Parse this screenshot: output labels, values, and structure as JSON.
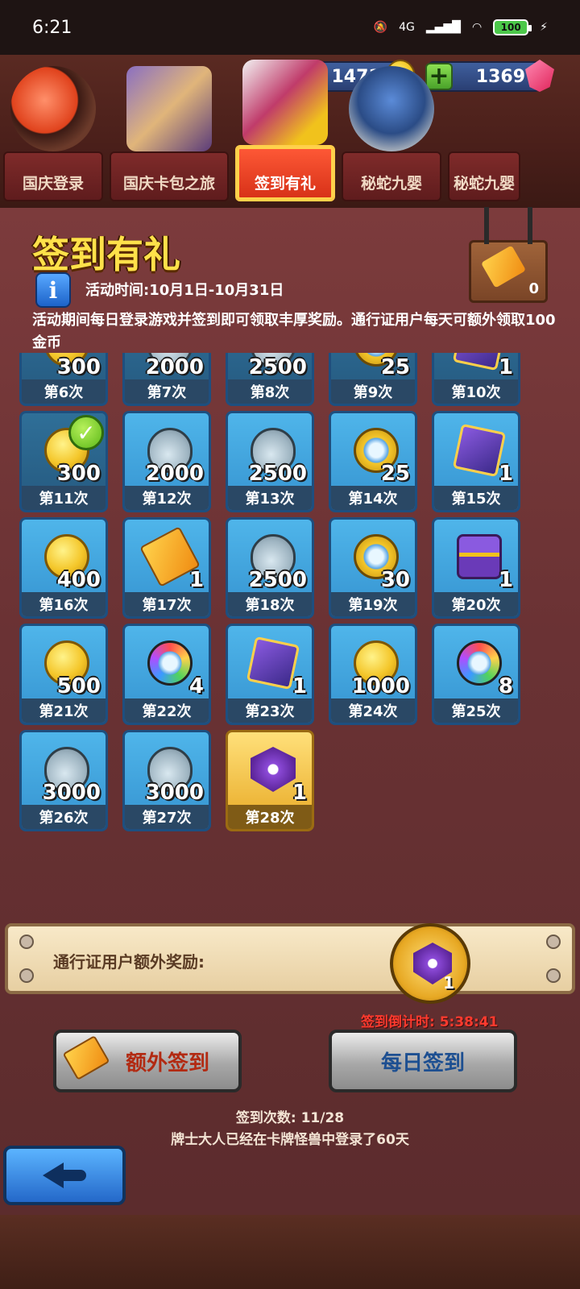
{
  "status_bar": {
    "time": "6:21",
    "network": "4G",
    "battery": "100"
  },
  "currencies": {
    "gold": "14716",
    "gems": "1369"
  },
  "tabs": [
    {
      "label": "国庆登录",
      "icon": "koi-fish-icon"
    },
    {
      "label": "国庆卡包之旅",
      "icon": "card-pack-icon"
    },
    {
      "label": "签到有礼",
      "icon": "calendar-gift-icon",
      "active": true
    },
    {
      "label": "秘蛇九婴",
      "icon": "hydra-icon"
    },
    {
      "label": "秘蛇九婴",
      "icon": "hydra-icon"
    }
  ],
  "event": {
    "title": "签到有礼",
    "period": "活动时间:10月1日-10月31日",
    "description": "活动期间每日登录游戏并签到即可领取丰厚奖励。通行证用户每天可额外领取100金币",
    "ticket_count": "0"
  },
  "rewards": [
    {
      "day": "第6次",
      "amount": "300",
      "icon": "coin",
      "claimed": true
    },
    {
      "day": "第7次",
      "amount": "2000",
      "icon": "potion",
      "claimed": true
    },
    {
      "day": "第8次",
      "amount": "2500",
      "icon": "potion",
      "claimed": true
    },
    {
      "day": "第9次",
      "amount": "25",
      "icon": "crystal-coin",
      "claimed": true
    },
    {
      "day": "第10次",
      "amount": "1",
      "icon": "card",
      "claimed": true
    },
    {
      "day": "第11次",
      "amount": "300",
      "icon": "coin",
      "claimed": true
    },
    {
      "day": "第12次",
      "amount": "2000",
      "icon": "potion",
      "claimed": false
    },
    {
      "day": "第13次",
      "amount": "2500",
      "icon": "potion",
      "claimed": false
    },
    {
      "day": "第14次",
      "amount": "25",
      "icon": "crystal-coin",
      "claimed": false
    },
    {
      "day": "第15次",
      "amount": "1",
      "icon": "card",
      "claimed": false
    },
    {
      "day": "第16次",
      "amount": "400",
      "icon": "coin",
      "claimed": false
    },
    {
      "day": "第17次",
      "amount": "1",
      "icon": "ticket",
      "claimed": false
    },
    {
      "day": "第18次",
      "amount": "2500",
      "icon": "potion",
      "claimed": false
    },
    {
      "day": "第19次",
      "amount": "30",
      "icon": "crystal-coin",
      "claimed": false
    },
    {
      "day": "第20次",
      "amount": "1",
      "icon": "chest",
      "claimed": false
    },
    {
      "day": "第21次",
      "amount": "500",
      "icon": "coin",
      "claimed": false
    },
    {
      "day": "第22次",
      "amount": "4",
      "icon": "rainbow",
      "claimed": false
    },
    {
      "day": "第23次",
      "amount": "1",
      "icon": "card",
      "claimed": false
    },
    {
      "day": "第24次",
      "amount": "1000",
      "icon": "coin",
      "claimed": false
    },
    {
      "day": "第25次",
      "amount": "8",
      "icon": "rainbow",
      "claimed": false
    },
    {
      "day": "第26次",
      "amount": "3000",
      "icon": "potion",
      "claimed": false
    },
    {
      "day": "第27次",
      "amount": "3000",
      "icon": "potion",
      "claimed": false
    },
    {
      "day": "第28次",
      "amount": "1",
      "icon": "badge",
      "claimed": false,
      "special": true
    }
  ],
  "pass_bonus": {
    "label": "通行证用户额外奖励:",
    "amount": "1",
    "icon": "badge"
  },
  "countdown": "签到倒计时: 5:38:41",
  "buttons": {
    "extra": "额外签到",
    "daily": "每日签到"
  },
  "sign_count": "签到次数: 11/28",
  "login_days": "牌士大人已经在卡牌怪兽中登录了60天"
}
